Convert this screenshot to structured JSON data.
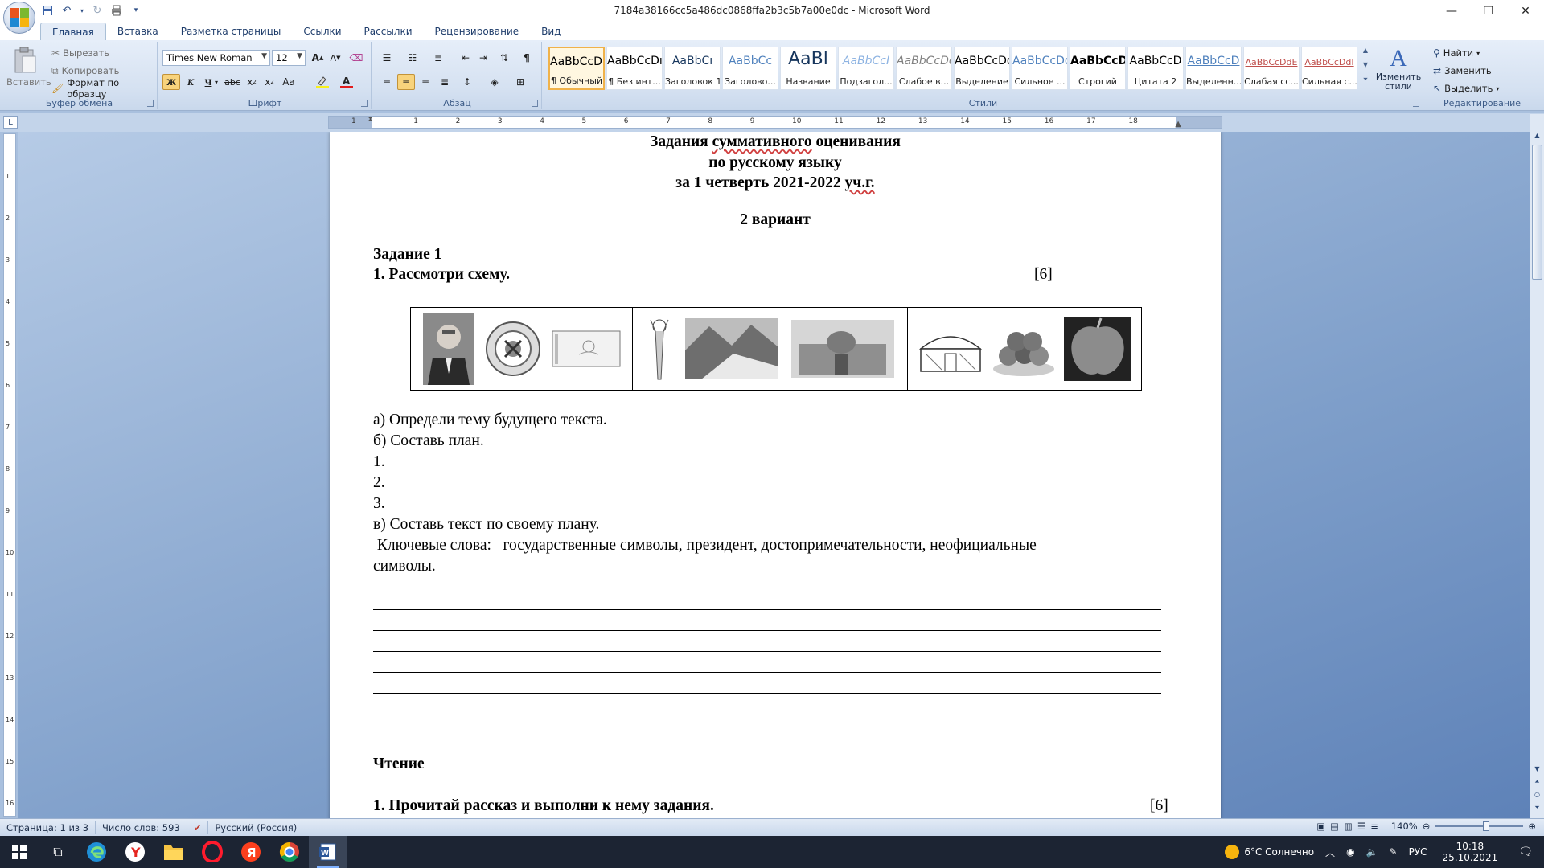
{
  "window": {
    "title": "7184a38166cc5a486dc0868ffa2b3c5b7a00e0dc - Microsoft Word"
  },
  "tabs": [
    {
      "label": "Главная",
      "active": true
    },
    {
      "label": "Вставка"
    },
    {
      "label": "Разметка страницы"
    },
    {
      "label": "Ссылки"
    },
    {
      "label": "Рассылки"
    },
    {
      "label": "Рецензирование"
    },
    {
      "label": "Вид"
    }
  ],
  "ribbon": {
    "clipboard": {
      "label": "Буфер обмена",
      "paste": "Вставить",
      "cut": "Вырезать",
      "copy": "Копировать",
      "format_painter": "Формат по образцу"
    },
    "font": {
      "label": "Шрифт",
      "family": "Times New Roman",
      "size": "12"
    },
    "paragraph": {
      "label": "Абзац"
    },
    "styles": {
      "label": "Стили",
      "change_styles": "Изменить стили",
      "items": [
        {
          "sample": "AaBbCcDı",
          "name": "¶ Обычный",
          "selected": true
        },
        {
          "sample": "AaBbCcDı",
          "name": "¶ Без инт..."
        },
        {
          "sample": "AaBbCı",
          "name": "Заголовок 1"
        },
        {
          "sample": "AaBbCc",
          "name": "Заголово..."
        },
        {
          "sample": "AaBl",
          "name": "Название"
        },
        {
          "sample": "AaBbCcI",
          "name": "Подзагол..."
        },
        {
          "sample": "AaBbCcDdI",
          "name": "Слабое в..."
        },
        {
          "sample": "AaBbCcDdI",
          "name": "Выделение"
        },
        {
          "sample": "AaBbCcDdI",
          "name": "Сильное ..."
        },
        {
          "sample": "AaBbCcDdE",
          "name": "Строгий"
        },
        {
          "sample": "AaBbCcD",
          "name": "Цитата 2"
        },
        {
          "sample": "AaBbCcD",
          "name": "Выделенн..."
        },
        {
          "sample": "AaBbCcDdE",
          "name": "Слабая сс..."
        },
        {
          "sample": "AaBbCcDdI",
          "name": "Сильная с..."
        }
      ]
    },
    "editing": {
      "label": "Редактирование",
      "find": "Найти",
      "replace": "Заменить",
      "select": "Выделить"
    }
  },
  "ruler": {
    "numbers": [
      "1",
      "1",
      "2",
      "3",
      "4",
      "5",
      "6",
      "7",
      "8",
      "9",
      "10",
      "11",
      "12",
      "13",
      "14",
      "15",
      "16",
      "17",
      "18"
    ],
    "v_numbers": [
      "1",
      "2",
      "3",
      "4",
      "5",
      "6",
      "7",
      "8",
      "9",
      "10",
      "11",
      "12",
      "13",
      "14",
      "15",
      "16"
    ]
  },
  "document": {
    "title_line1_a": "Задания ",
    "title_line1_b": "суммативного",
    "title_line1_c": " оценивания",
    "title_line2": "по  русскому  языку",
    "title_line3_a": "за 1 четверть  2021-2022 ",
    "title_line3_b": "уч.г.",
    "variant": "2 вариант",
    "task_heading": "Задание 1",
    "task_item": "1. Рассмотри  схему.",
    "task_points": "[6]",
    "lines": [
      "а) Определи тему будущего текста.",
      "б) Составь план.",
      "1.",
      "2.",
      "3.",
      "в) Составь текст по своему плану.",
      " Ключевые слова:   государственные символы, президент, достопримечательности, неофициальные",
      "символы."
    ],
    "reading_heading": "Чтение",
    "reading_item": "1. Прочитай рассказ и выполни к нему задания.",
    "reading_points": "[6]"
  },
  "statusbar": {
    "page": "Страница: 1 из 3",
    "words": "Число слов: 593",
    "language": "Русский (Россия)",
    "zoom": "140%"
  },
  "taskbar": {
    "weather": "6°C  Солнечно",
    "lang": "РУС",
    "time": "10:18",
    "date": "25.10.2021"
  }
}
